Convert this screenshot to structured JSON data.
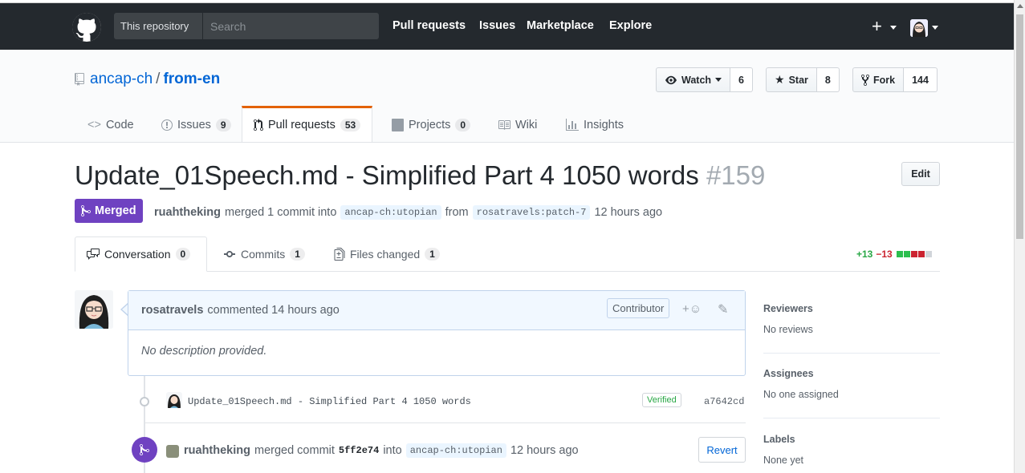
{
  "header": {
    "scope_label": "This repository",
    "search_placeholder": "Search",
    "nav": [
      "Pull requests",
      "Issues",
      "Marketplace",
      "Explore"
    ],
    "plus": "+"
  },
  "repo": {
    "owner": "ancap-ch",
    "separator": "/",
    "name": "from-en",
    "watch": {
      "label": "Watch",
      "count": "6"
    },
    "star": {
      "label": "Star",
      "count": "8"
    },
    "fork": {
      "label": "Fork",
      "count": "144"
    },
    "tabs": [
      {
        "label": "Code",
        "icon": "code-icon"
      },
      {
        "label": "Issues",
        "icon": "issue-icon",
        "count": "9"
      },
      {
        "label": "Pull requests",
        "icon": "pull-request-icon",
        "count": "53"
      },
      {
        "label": "Projects",
        "icon": "project-icon",
        "count": "0"
      },
      {
        "label": "Wiki",
        "icon": "book-icon"
      },
      {
        "label": "Insights",
        "icon": "graph-icon"
      }
    ]
  },
  "pr": {
    "title": "Update_01Speech.md - Simplified Part 4 1050 words",
    "number": "#159",
    "edit_label": "Edit",
    "state": "Merged",
    "merger": "ruahtheking",
    "merged_text": "merged 1 commit into",
    "base_ref": "ancap-ch:utopian",
    "from_text": "from",
    "head_ref": "rosatravels:patch-7",
    "time": "12 hours ago",
    "tabs": [
      {
        "label": "Conversation",
        "count": "0",
        "icon": "comment-discussion-icon"
      },
      {
        "label": "Commits",
        "count": "1",
        "icon": "git-commit-icon"
      },
      {
        "label": "Files changed",
        "count": "1",
        "icon": "file-diff-icon"
      }
    ],
    "diffstat": {
      "additions": "+13",
      "deletions": "−13"
    }
  },
  "comment": {
    "author": "rosatravels",
    "action": "commented 14 hours ago",
    "badge": "Contributor",
    "body": "No description provided."
  },
  "commit": {
    "message": "Update_01Speech.md - Simplified Part 4 1050 words",
    "verified": "Verified",
    "sha": "a7642cd"
  },
  "merge_event": {
    "actor": "ruahtheking",
    "text1": "merged commit",
    "sha": "5ff2e74",
    "text2": "into",
    "ref": "ancap-ch:utopian",
    "time": "12 hours ago",
    "revert_label": "Revert"
  },
  "sidebar": {
    "reviewers": {
      "title": "Reviewers",
      "value": "No reviews"
    },
    "assignees": {
      "title": "Assignees",
      "value": "No one assigned"
    },
    "labels": {
      "title": "Labels",
      "value": "None yet"
    }
  },
  "colors": {
    "header_bg": "#24292e",
    "merged": "#6f42c1",
    "link": "#0366d6",
    "tab_accent": "#e36209",
    "add": "#28a745",
    "del": "#cb2431"
  }
}
